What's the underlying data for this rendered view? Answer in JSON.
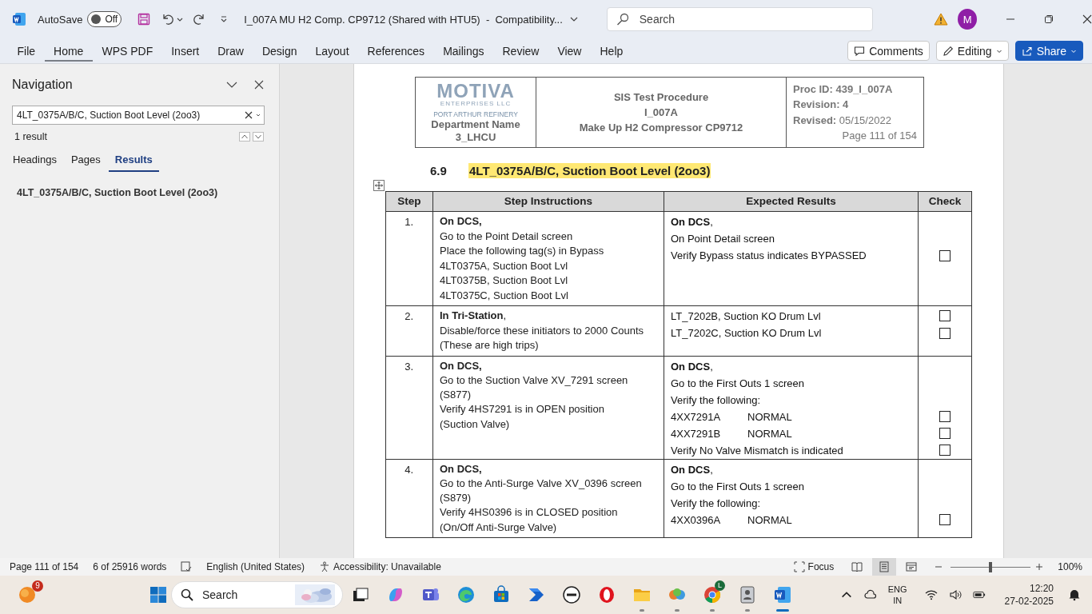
{
  "titlebar": {
    "autosave_label": "AutoSave",
    "autosave": {
      "on": false,
      "label": "Off"
    },
    "document_title": "I_007A MU H2 Comp. CP9712 (Shared with HTU5)  -  Compatibility...",
    "search": {
      "placeholder": "Search"
    },
    "avatar": "M"
  },
  "ribbon": {
    "tabs": [
      {
        "label": "File",
        "selected": false
      },
      {
        "label": "Home",
        "selected": true
      },
      {
        "label": "WPS PDF",
        "selected": false
      },
      {
        "label": "Insert",
        "selected": false
      },
      {
        "label": "Draw",
        "selected": false
      },
      {
        "label": "Design",
        "selected": false
      },
      {
        "label": "Layout",
        "selected": false
      },
      {
        "label": "References",
        "selected": false
      },
      {
        "label": "Mailings",
        "selected": false
      },
      {
        "label": "Review",
        "selected": false
      },
      {
        "label": "View",
        "selected": false
      },
      {
        "label": "Help",
        "selected": false
      }
    ],
    "comments": "Comments",
    "editing": "Editing",
    "share": "Share"
  },
  "navigation": {
    "title": "Navigation",
    "search": {
      "value": "4LT_0375A/B/C, Suction Boot Level (2oo3)"
    },
    "result_count": "1 result",
    "tabs": [
      {
        "label": "Headings",
        "selected": false
      },
      {
        "label": "Pages",
        "selected": false
      },
      {
        "label": "Results",
        "selected": true
      }
    ],
    "results": [
      "4LT_0375A/B/C, Suction Boot Level (2oo3)"
    ]
  },
  "document": {
    "header": {
      "logo": "MOTIVA",
      "logo_sub": "ENTERPRISES LLC",
      "site": "PORT ARTHUR REFINERY",
      "department": "Department Name",
      "unit": "3_LHCU",
      "title_lines": [
        "SIS Test Procedure",
        "I_007A",
        "Make Up H2 Compressor CP9712"
      ],
      "proc_lines": [
        "**Proc ID: 439_I_007A**",
        "**Revision: 4**",
        "**Revised:** 05/15/2022"
      ],
      "page": "Page 111 of 154"
    },
    "section": {
      "number": "6.9",
      "title": "4LT_0375A/B/C, Suction Boot Level (2oo3)",
      "highlighted": true
    },
    "table": {
      "columns": [
        "Step",
        "Step Instructions",
        "Expected Results",
        "Check"
      ],
      "rows": [
        {
          "step": "1.",
          "instructions": [
            {
              "kind": "bold",
              "text": "On DCS,"
            },
            {
              "kind": "text",
              "text": "Go to the Point Detail screen"
            },
            {
              "kind": "text",
              "text": "Place the following tag(s) in Bypass"
            },
            {
              "kind": "text",
              "text": "4LT0375A, Suction Boot Lvl"
            },
            {
              "kind": "text",
              "text": "4LT0375B, Suction Boot Lvl"
            },
            {
              "kind": "text",
              "text": "4LT0375C, Suction Boot Lvl"
            }
          ],
          "results": [
            {
              "text": "**On DCS**,"
            },
            {
              "text": "On Point Detail screen"
            },
            {
              "text": "Verify Bypass status indicates BYPASSED",
              "checked": false
            }
          ]
        },
        {
          "step": "2.",
          "instructions": [
            {
              "kind": "text",
              "text": "**In Tri-Station**,"
            },
            {
              "kind": "text",
              "text": "Disable/force these initiators to 2000 Counts"
            },
            {
              "kind": "text",
              "text": "(These are high trips)"
            }
          ],
          "results": [
            {
              "text": "LT_7202B, Suction KO Drum Lvl",
              "checked": false
            },
            {
              "text": "LT_7202C, Suction KO Drum Lvl",
              "checked": false
            }
          ]
        },
        {
          "step": "3.",
          "instructions": [
            {
              "kind": "bold",
              "text": "On DCS,"
            },
            {
              "kind": "text",
              "text": "Go to the Suction Valve XV_7291 screen (S877)"
            },
            {
              "kind": "text",
              "text": "Verify 4HS7291 is in OPEN position"
            },
            {
              "kind": "text",
              "text": "(Suction Valve)"
            }
          ],
          "results": [
            {
              "text": "**On DCS**,"
            },
            {
              "text": "Go to the First Outs 1 screen"
            },
            {
              "text": "Verify the following:"
            },
            {
              "text": "4XX7291A",
              "status": "NORMAL",
              "checked": false
            },
            {
              "text": "4XX7291B",
              "status": "NORMAL",
              "checked": false
            },
            {
              "text": "Verify No Valve Mismatch is indicated",
              "checked": false
            }
          ]
        },
        {
          "step": "4.",
          "instructions": [
            {
              "kind": "bold",
              "text": "On DCS,"
            },
            {
              "kind": "text",
              "text": "Go to the Anti-Surge Valve XV_0396 screen (S879)"
            },
            {
              "kind": "text",
              "text": "Verify 4HS0396 is in CLOSED position"
            },
            {
              "kind": "text",
              "text": "(On/Off Anti-Surge Valve)"
            }
          ],
          "results": [
            {
              "text": "**On DCS**,"
            },
            {
              "text": "Go to the First Outs 1 screen"
            },
            {
              "text": "Verify the following:"
            },
            {
              "text": "4XX0396A",
              "status": "NORMAL",
              "checked": false
            }
          ]
        }
      ]
    }
  },
  "status_bar": {
    "page": "Page 111 of 154",
    "words": "6 of 25916 words",
    "language": "English (United States)",
    "accessibility": "Accessibility: Unavailable",
    "focus": "Focus",
    "views": [
      {
        "kind": "read",
        "selected": false
      },
      {
        "kind": "print",
        "selected": true
      },
      {
        "kind": "web",
        "selected": false
      }
    ],
    "zoom": {
      "level": 0.5,
      "label": "100%"
    }
  },
  "taskbar": {
    "weather_badge": "9",
    "search": {
      "placeholder": "Search"
    },
    "apps": [
      {
        "kind": "taskview"
      },
      {
        "kind": "copilot"
      },
      {
        "kind": "teams"
      },
      {
        "kind": "edge"
      },
      {
        "kind": "store"
      },
      {
        "kind": "automate"
      },
      {
        "kind": "dell"
      },
      {
        "kind": "opera"
      },
      {
        "kind": "folder",
        "running": true,
        "active": false
      },
      {
        "kind": "people",
        "running": true,
        "active": false
      },
      {
        "kind": "chrome",
        "running": true,
        "active": false,
        "badge": "L"
      },
      {
        "kind": "contact",
        "running": true,
        "active": false
      },
      {
        "kind": "word",
        "running": true,
        "active": true
      }
    ],
    "language": "ENG",
    "region": "IN",
    "time": "12:20",
    "date": "27-02-2025"
  }
}
